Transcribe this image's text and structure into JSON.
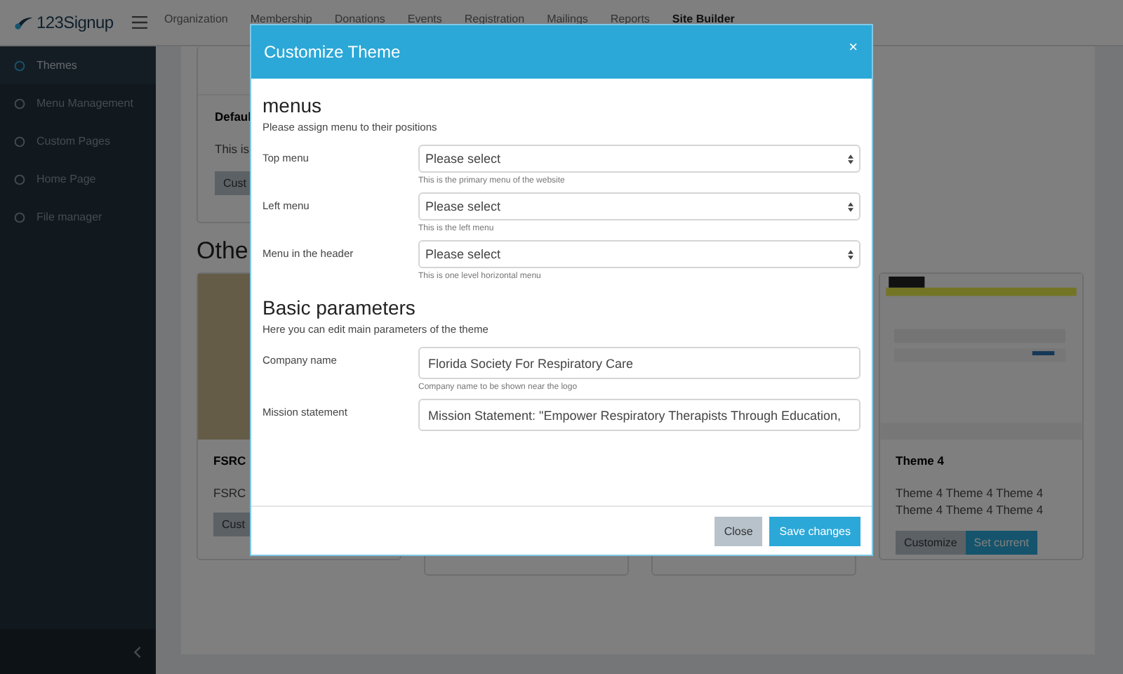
{
  "header": {
    "logo": "123Signup",
    "nav": [
      {
        "label": "Organization",
        "selected": false
      },
      {
        "label": "Membership",
        "selected": false
      },
      {
        "label": "Donations",
        "selected": false
      },
      {
        "label": "Events",
        "selected": false
      },
      {
        "label": "Registration",
        "selected": false
      },
      {
        "label": "Mailings",
        "selected": false
      },
      {
        "label": "Reports",
        "selected": false
      },
      {
        "label": "Site Builder",
        "selected": true
      }
    ]
  },
  "sidebar": {
    "items": [
      {
        "label": "Themes",
        "selected": true
      },
      {
        "label": "Menu Management",
        "selected": false
      },
      {
        "label": "Custom Pages",
        "selected": false
      },
      {
        "label": "Home Page",
        "selected": false
      },
      {
        "label": "File manager",
        "selected": false
      }
    ]
  },
  "page": {
    "current_theme": {
      "title": "Defaul",
      "description": "This is",
      "button": "Cust"
    },
    "other_heading": "Othe",
    "themes": [
      {
        "title": "FSRC",
        "description": "FSRC",
        "buttons": [
          "Cust"
        ]
      },
      {
        "title": "Theme 4",
        "description": "Theme 4 Theme 4 Theme 4 Theme 4 Theme 4 Theme 4",
        "buttons": [
          "Customize",
          "Set current"
        ]
      }
    ]
  },
  "modal": {
    "title": "Customize Theme",
    "close": "×",
    "sections": [
      {
        "heading": "menus",
        "description": "Please assign menu to their positions",
        "fields": [
          {
            "kind": "select",
            "label": "Top menu",
            "value": "Please select",
            "hint": "This is the primary menu of the website"
          },
          {
            "kind": "select",
            "label": "Left menu",
            "value": "Please select",
            "hint": "This is the left menu"
          },
          {
            "kind": "select",
            "label": "Menu in the header",
            "value": "Please select",
            "hint": "This is one level horizontal menu"
          }
        ]
      },
      {
        "heading": "Basic parameters",
        "description": "Here you can edit main parameters of the theme",
        "fields": [
          {
            "kind": "text",
            "label": "Company name",
            "value": "Florida Society For Respiratory Care",
            "hint": "Company name to be shown near the logo"
          },
          {
            "kind": "text",
            "label": "Mission statement",
            "value": "Mission Statement: \"Empower Respiratory Therapists Through Education,"
          }
        ]
      }
    ],
    "buttons": [
      {
        "label": "Close",
        "kind": "secondary"
      },
      {
        "label": "Save changes",
        "kind": "primary"
      }
    ]
  }
}
